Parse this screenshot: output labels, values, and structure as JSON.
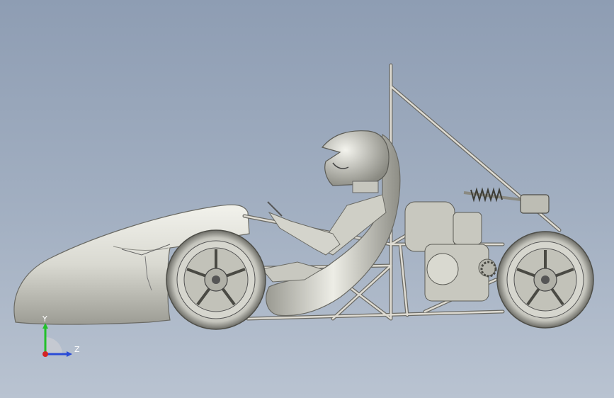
{
  "viewport": {
    "background_top": "#8e9db3",
    "background_bottom": "#b9c3d1",
    "model_color": "#d8d8d0"
  },
  "triad": {
    "y_label": "Y",
    "z_label": "Z",
    "y_color": "#22c02a",
    "z_color": "#2a4bd6",
    "x_color": "#d42424"
  }
}
